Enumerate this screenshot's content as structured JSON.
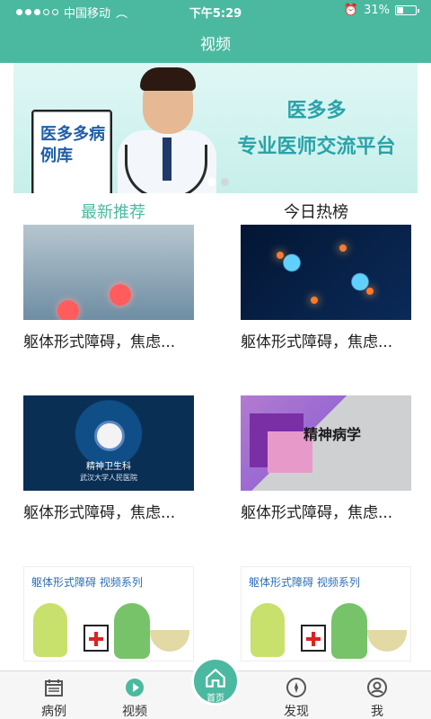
{
  "status_bar": {
    "carrier": "中国移动",
    "time": "下午5:29",
    "battery": "31%",
    "battery_level": 0.31
  },
  "nav": {
    "title": "视频"
  },
  "banner": {
    "card_text": "医多多病例库",
    "brand_line1": "医多多",
    "brand_line2": "专业医师交流平台",
    "dots": 2,
    "active_index": 1
  },
  "tabs": [
    {
      "label": "最新推荐",
      "active": true
    },
    {
      "label": "今日热榜",
      "active": false
    }
  ],
  "videos": [
    {
      "title": "躯体形式障碍，焦虑...",
      "thumb_style": "spine"
    },
    {
      "title": "躯体形式障碍，焦虑...",
      "thumb_style": "neuron"
    },
    {
      "title": "躯体形式障碍，焦虑...",
      "thumb_style": "emblem",
      "thumb_text1": "精神卫生科",
      "thumb_text2": "武汉大学人民医院"
    },
    {
      "title": "躯体形式障碍，焦虑...",
      "thumb_style": "book",
      "thumb_text": "精神病学"
    },
    {
      "title": "",
      "thumb_style": "cartoon",
      "thumb_caption": "躯体形式障碍 视频系列"
    },
    {
      "title": "",
      "thumb_style": "cartoon",
      "thumb_caption": "躯体形式障碍 视频系列"
    }
  ],
  "tabbar": {
    "items": [
      {
        "label": "病例",
        "icon": "calendar-icon"
      },
      {
        "label": "视频",
        "icon": "play-icon"
      },
      {
        "label": "首页",
        "icon": "home-icon"
      },
      {
        "label": "发现",
        "icon": "compass-icon"
      },
      {
        "label": "我",
        "icon": "profile-icon"
      }
    ]
  }
}
